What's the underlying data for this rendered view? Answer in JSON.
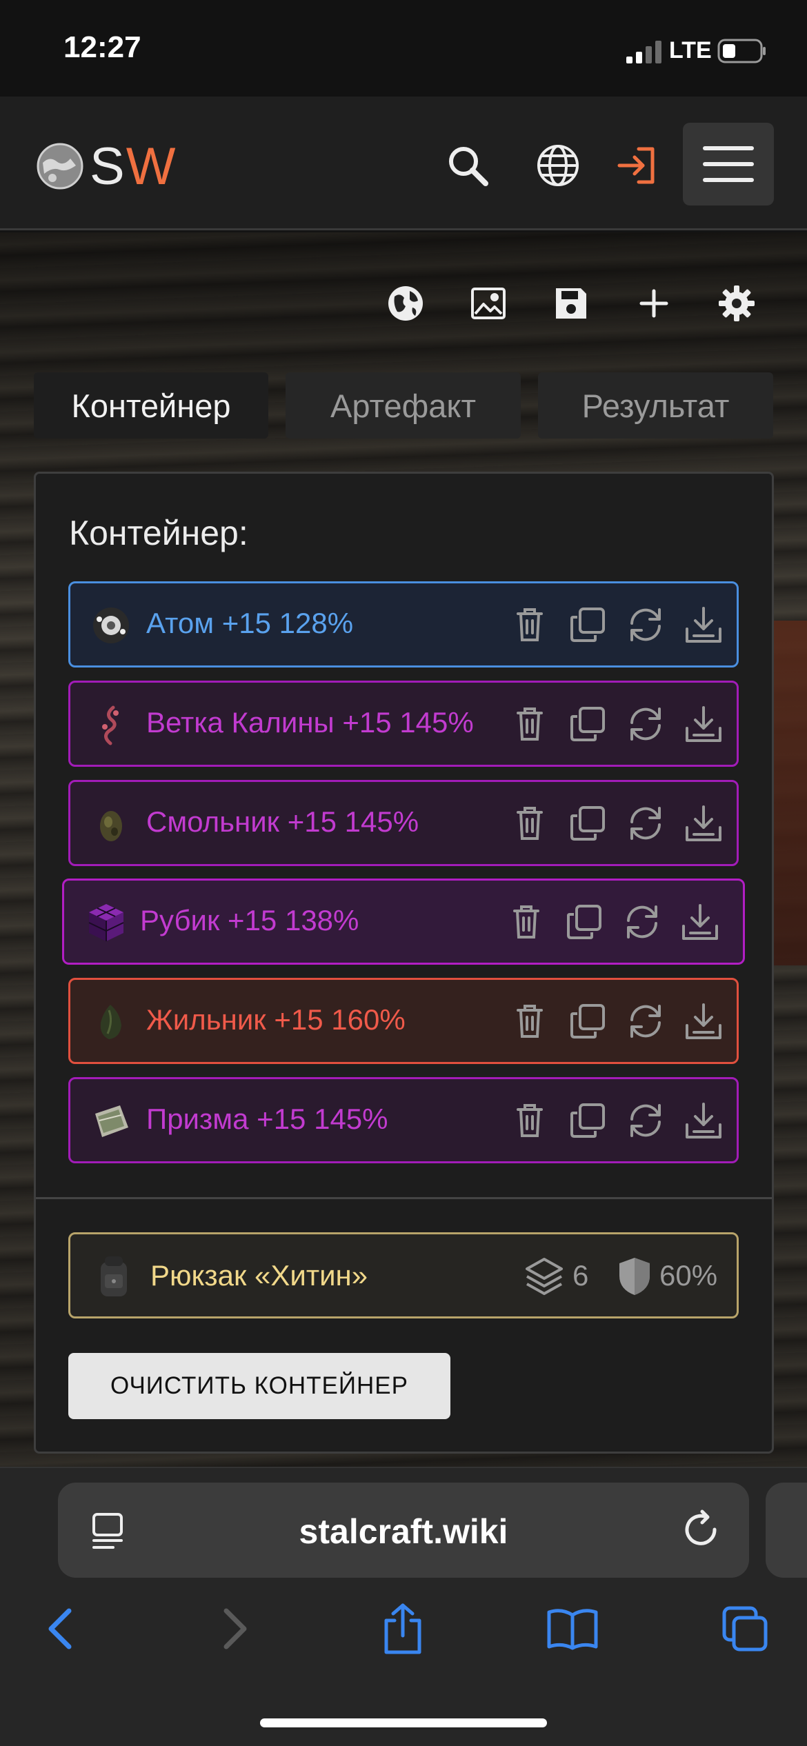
{
  "status_bar": {
    "time": "12:27",
    "network": "LTE"
  },
  "header": {
    "logo_s": "S",
    "logo_w": "W",
    "icons": [
      "search-icon",
      "globe-icon",
      "login-icon",
      "menu-icon"
    ],
    "accent_color": "#f07040"
  },
  "toolbar": {
    "icons": [
      "world-icon",
      "image-icon",
      "save-icon",
      "plus-icon",
      "gear-icon"
    ]
  },
  "tabs": [
    {
      "label": "Контейнер",
      "active": true
    },
    {
      "label": "Артефакт",
      "active": false
    },
    {
      "label": "Результат",
      "active": false
    }
  ],
  "panel": {
    "title": "Контейнер:",
    "items": [
      {
        "name": "Атом +15 128%",
        "color": "#5aa2ee",
        "border": "#4a8fe0",
        "bg": "#1c2435"
      },
      {
        "name": "Ветка Калины +15 145%",
        "color": "#c23bd0",
        "border": "#a21cb8",
        "bg": "#2a1a2e"
      },
      {
        "name": "Смольник +15 145%",
        "color": "#c23bd0",
        "border": "#a21cb8",
        "bg": "#2a1a2e"
      },
      {
        "name": "Рубик +15 138%",
        "color": "#c23bd0",
        "border": "#b21ec4",
        "bg": "#321a3a"
      },
      {
        "name": "Жильник +15 160%",
        "color": "#f05a4a",
        "border": "#e0503e",
        "bg": "#34211e"
      },
      {
        "name": "Призма +15 145%",
        "color": "#c23bd0",
        "border": "#a21cb8",
        "bg": "#2a1a2e"
      }
    ],
    "item_actions": [
      "trash-icon",
      "copy-icon",
      "refresh-icon",
      "download-icon"
    ],
    "backpack": {
      "name": "Рюкзак «Хитин»",
      "slots": "6",
      "protection": "60%"
    },
    "clear_button": "ОЧИСТИТЬ КОНТЕЙНЕР"
  },
  "browser": {
    "url": "stalcraft.wiki",
    "nav_icons": [
      "back-icon",
      "forward-icon",
      "share-icon",
      "bookmarks-icon",
      "tabs-icon"
    ],
    "accent_color": "#3a86f0"
  }
}
